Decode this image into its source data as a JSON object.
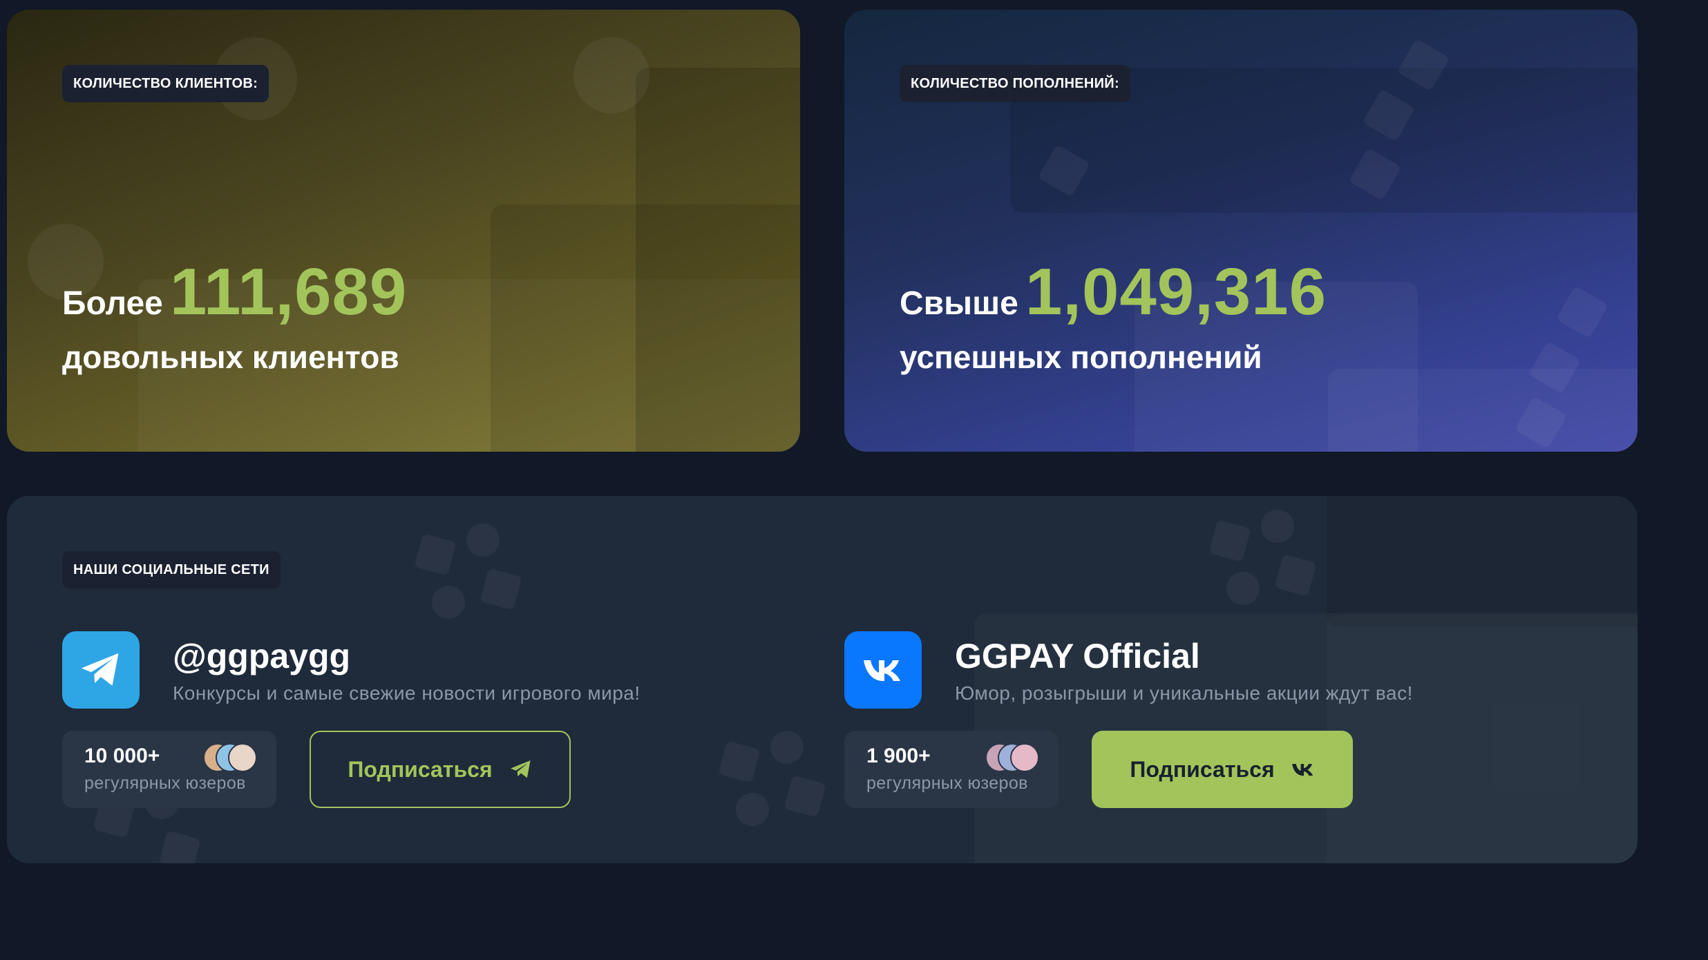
{
  "clients": {
    "badge": "КОЛИЧЕСТВО КЛИЕНТОВ:",
    "prefix": "Более",
    "value": "111,689",
    "caption": "довольных клиентов"
  },
  "topups": {
    "badge": "КОЛИЧЕСТВО ПОПОЛНЕНИЙ:",
    "prefix": "Свыше",
    "value": "1,049,316",
    "caption": "успешных пополнений"
  },
  "social": {
    "badge": "НАШИ СОЦИАЛЬНЫЕ СЕТИ",
    "telegram": {
      "icon": "telegram-icon",
      "name": "@ggpaygg",
      "description": "Конкурсы и самые свежие новости игрового мира!",
      "count": "10 000+",
      "count_label": "регулярных юзеров",
      "button_label": "Подписаться",
      "color": "#2ea6e6"
    },
    "vk": {
      "icon": "vk-icon",
      "name": "GGPAY Official",
      "description": "Юмор, розыгрыши и уникальные акции ждут вас!",
      "count": "1 900+",
      "count_label": "регулярных юзеров",
      "button_label": "Подписаться",
      "color": "#0a77ff"
    }
  },
  "colors": {
    "accent": "#a3c45b",
    "background": "#111827",
    "card": "#1f2a3a"
  }
}
